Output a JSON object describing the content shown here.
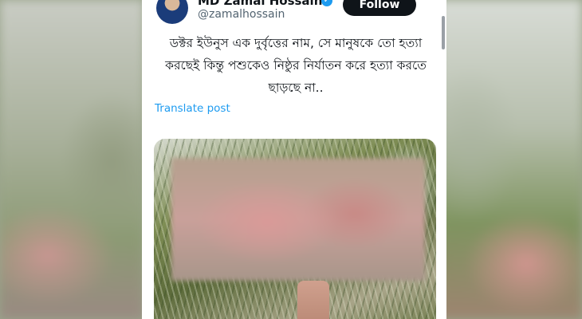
{
  "post": {
    "author_name": "MD Zamal Hossain",
    "handle": "@zamalhossain",
    "follow_label": "Follow",
    "text": "ডক্টর ইউনুস এক দুর্বৃত্তের নাম,  সে মানুষকে তো হত্যা করছেই কিন্তু পশুকেও নিষ্ঠুর নির্যাতন করে হত্যা করতে ছাড়ছে না..",
    "translate_label": "Translate post"
  },
  "colors": {
    "follow_bg": "#0f1419",
    "link": "#1d9bf0",
    "verified": "#1d9bf0"
  }
}
